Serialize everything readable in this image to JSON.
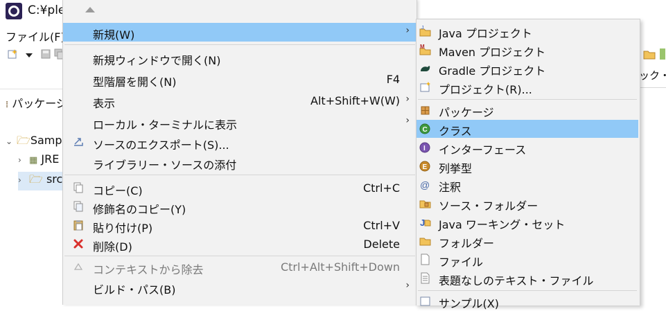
{
  "window": {
    "title": "C:¥ple",
    "menu_file": "ファイル(F)"
  },
  "left_panel": {
    "tab_label": "パッケージ",
    "tree": [
      {
        "label": "Samp",
        "expanded": true
      },
      {
        "label": "JRE",
        "expanded": false
      },
      {
        "label": "src",
        "expanded": false
      }
    ]
  },
  "right_strip": {
    "text": "ック・ア"
  },
  "context_menu": {
    "items": [
      {
        "label": "新規(W)",
        "accel": "",
        "submenu": true,
        "highlighted": true
      },
      {
        "label": "新規ウィンドウで開く(N)",
        "accel": ""
      },
      {
        "label": "型階層を開く(N)",
        "accel": "F4"
      },
      {
        "label": "表示",
        "accel": "Alt+Shift+W(W)",
        "submenu": true
      },
      {
        "label": "ローカル・ターミナルに表示",
        "accel": "",
        "submenu": true
      },
      {
        "label": "ソースのエクスポート(S)...",
        "accel": "",
        "icon": "export-icon"
      },
      {
        "label": "ライブラリー・ソースの添付",
        "accel": ""
      },
      {
        "label": "コピー(C)",
        "accel": "Ctrl+C",
        "icon": "copy-icon"
      },
      {
        "label": "修飾名のコピー(Y)",
        "accel": "",
        "icon": "copy-qualified-icon"
      },
      {
        "label": "貼り付け(P)",
        "accel": "Ctrl+V",
        "icon": "paste-icon"
      },
      {
        "label": "削除(D)",
        "accel": "Delete",
        "icon": "delete-icon"
      },
      {
        "label": "コンテキストから除去",
        "accel": "Ctrl+Alt+Shift+Down",
        "disabled": true,
        "icon": "remove-context-icon"
      },
      {
        "label": "ビルド・パス(B)",
        "accel": "",
        "submenu": true
      }
    ]
  },
  "submenu": {
    "items": [
      {
        "label": "Java プロジェクト",
        "icon": "java-project-icon"
      },
      {
        "label": "Maven プロジェクト",
        "icon": "maven-project-icon"
      },
      {
        "label": "Gradle プロジェクト",
        "icon": "gradle-project-icon"
      },
      {
        "label": "プロジェクト(R)...",
        "icon": "project-icon"
      },
      {
        "label": "パッケージ",
        "icon": "package-icon"
      },
      {
        "label": "クラス",
        "icon": "class-icon",
        "highlighted": true
      },
      {
        "label": "インターフェース",
        "icon": "interface-icon"
      },
      {
        "label": "列挙型",
        "icon": "enum-icon"
      },
      {
        "label": "注釈",
        "icon": "annotation-icon"
      },
      {
        "label": "ソース・フォルダー",
        "icon": "source-folder-icon"
      },
      {
        "label": "Java ワーキング・セット",
        "icon": "working-set-icon"
      },
      {
        "label": "フォルダー",
        "icon": "folder-icon"
      },
      {
        "label": "ファイル",
        "icon": "file-icon"
      },
      {
        "label": "表題なしのテキスト・ファイル",
        "icon": "text-file-icon"
      },
      {
        "label": "サンプル(X)",
        "icon": "sample-icon"
      }
    ]
  },
  "colors": {
    "highlight": "#91c9f7",
    "menu_bg": "#f2f2f2",
    "disabled_text": "#7a7a7a"
  }
}
